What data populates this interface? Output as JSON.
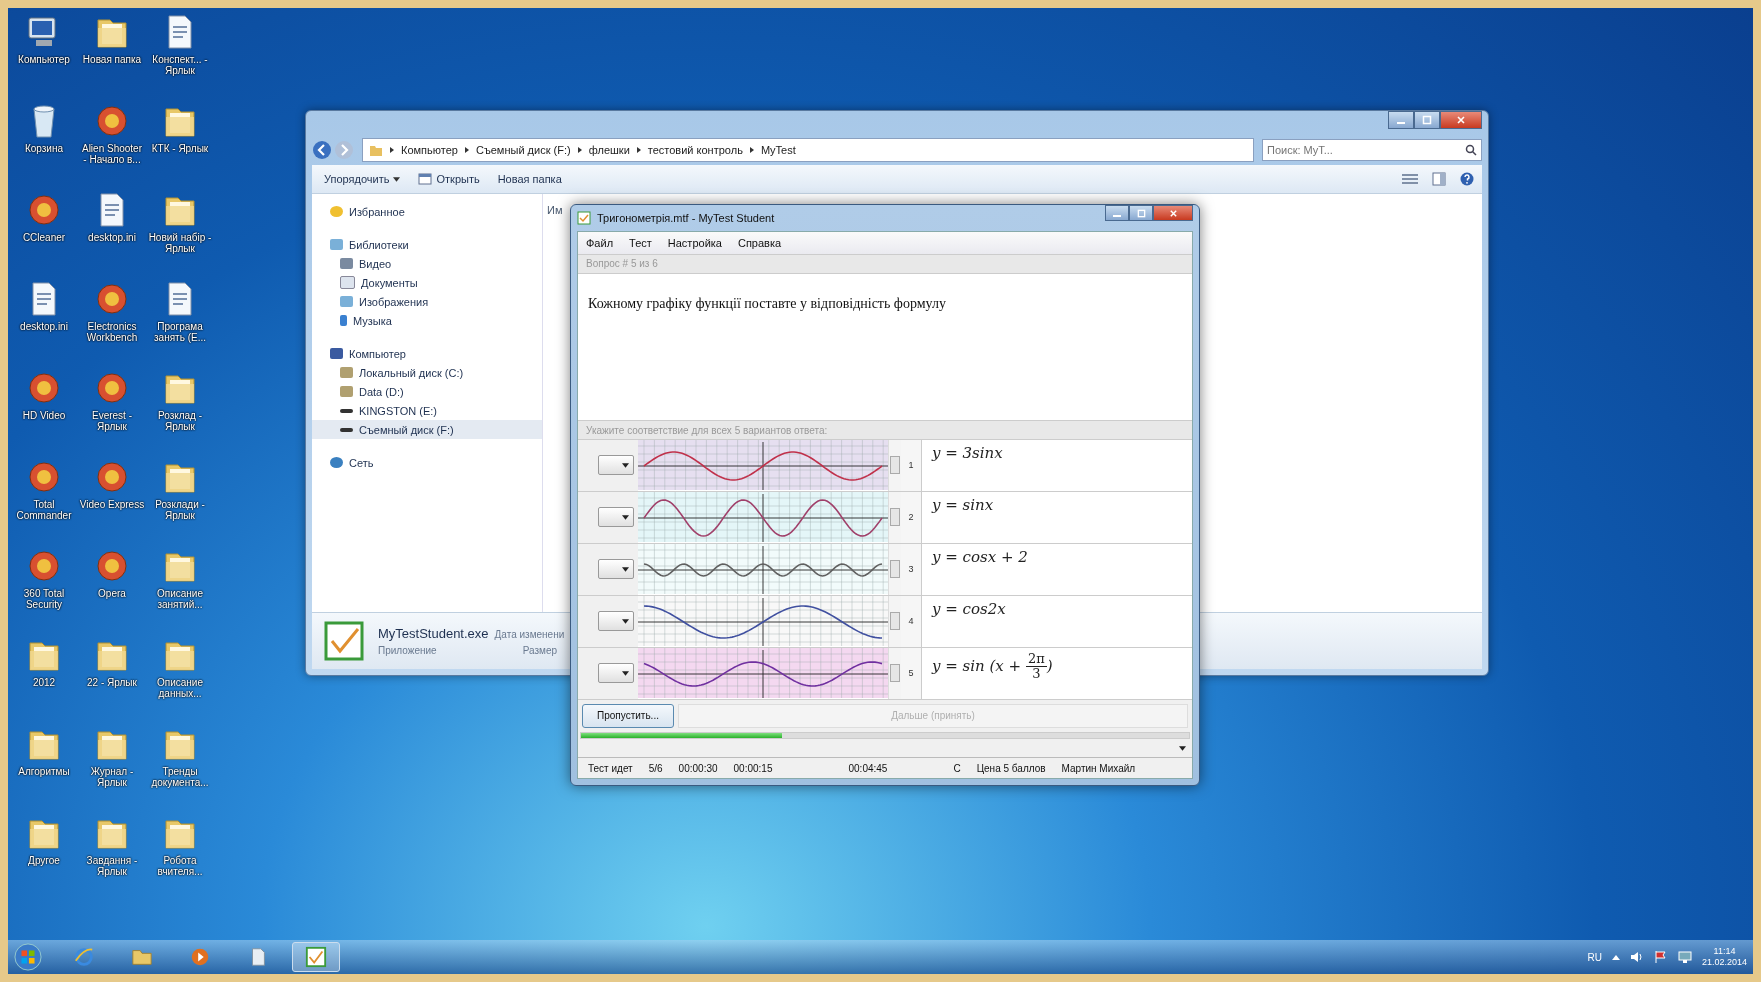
{
  "desktop_icons": [
    {
      "label": "Компьютер",
      "kind": "computer"
    },
    {
      "label": "Новая папка",
      "kind": "folder"
    },
    {
      "label": "Конспект... - Ярлык",
      "kind": "document"
    },
    {
      "label": "Корзина",
      "kind": "trash"
    },
    {
      "label": "Alien Shooter - Начало в...",
      "kind": "app"
    },
    {
      "label": "КТК - Ярлык",
      "kind": "folder"
    },
    {
      "label": "CCleaner",
      "kind": "app"
    },
    {
      "label": "desktop.ini",
      "kind": "document"
    },
    {
      "label": "Новий набір - Ярлык",
      "kind": "folder"
    },
    {
      "label": "desktop.ini",
      "kind": "document"
    },
    {
      "label": "Electronics Workbench",
      "kind": "app"
    },
    {
      "label": "Програма занять (Е...",
      "kind": "document"
    },
    {
      "label": "HD Video",
      "kind": "app"
    },
    {
      "label": "Everest - Ярлык",
      "kind": "app"
    },
    {
      "label": "Розклад - Ярлык",
      "kind": "folder"
    },
    {
      "label": "Total Commander",
      "kind": "app"
    },
    {
      "label": "Video Express",
      "kind": "app"
    },
    {
      "label": "Розклади - Ярлык",
      "kind": "folder"
    },
    {
      "label": "360 Total Security",
      "kind": "app"
    },
    {
      "label": "Opera",
      "kind": "app"
    },
    {
      "label": "Описание занятий...",
      "kind": "folder"
    },
    {
      "label": "2012",
      "kind": "folder"
    },
    {
      "label": "22 - Ярлык",
      "kind": "folder"
    },
    {
      "label": "Описание данных...",
      "kind": "folder"
    },
    {
      "label": "Алгоритмы",
      "kind": "folder"
    },
    {
      "label": "Журнал - Ярлык",
      "kind": "folder"
    },
    {
      "label": "Тренды документа...",
      "kind": "folder"
    },
    {
      "label": "Другое",
      "kind": "folder"
    },
    {
      "label": "Завдання - Ярлык",
      "kind": "folder"
    },
    {
      "label": "Робота вчителя...",
      "kind": "folder"
    }
  ],
  "explorer": {
    "breadcrumb": [
      "Компьютер",
      "Съемный диск (F:)",
      "флешки",
      "тестовий контроль",
      "MyTest"
    ],
    "search": {
      "placeholder": "Поиск: MyT..."
    },
    "toolbar": [
      {
        "label": "Упорядочить",
        "kind": "menu"
      },
      {
        "label": "Открыть",
        "kind": "open"
      },
      {
        "label": "Новая папка",
        "kind": "plain"
      }
    ],
    "sidebar": [
      {
        "label": "Избранное",
        "kind": "star",
        "selected": false
      },
      {
        "label": "Библиотеки",
        "kind": "library",
        "selected": false,
        "children": [
          {
            "label": "Видео",
            "kind": "video",
            "selected": false
          },
          {
            "label": "Документы",
            "kind": "document",
            "selected": false
          },
          {
            "label": "Изображения",
            "kind": "picture",
            "selected": false
          },
          {
            "label": "Музыка",
            "kind": "music",
            "selected": false
          }
        ]
      },
      {
        "label": "Компьютер",
        "kind": "computer",
        "selected": false,
        "children": [
          {
            "label": "Локальный диск (C:)",
            "kind": "disk",
            "selected": false
          },
          {
            "label": "Data (D:)",
            "kind": "disk",
            "selected": false
          },
          {
            "label": "KINGSTON (E:)",
            "kind": "usb",
            "selected": false
          },
          {
            "label": "Съемный диск (F:)",
            "kind": "usb",
            "selected": true
          }
        ]
      },
      {
        "label": "Сеть",
        "kind": "network",
        "selected": false
      }
    ],
    "list_header": "Им",
    "details": {
      "name": "MyTestStudent.exe",
      "modified_label": "Дата изменени",
      "type": "Приложение",
      "size_label": "Размер"
    }
  },
  "mytest": {
    "title": "Тригонометрія.mtf - MyTest Student",
    "menu": [
      "Файл",
      "Тест",
      "Настройка",
      "Справка"
    ],
    "question_number": "Вопрос # 5 из 6",
    "question": "Кожному графіку функції поставте у відповідність формулу",
    "instruction": "Укажите соответствие для всех 5 вариантов ответа:",
    "rows": [
      {
        "number": "1",
        "formula": {
          "kind": "plain",
          "text": "y = 3sinx"
        }
      },
      {
        "number": "2",
        "formula": {
          "kind": "plain",
          "text": "y = sinx"
        }
      },
      {
        "number": "3",
        "formula": {
          "kind": "plain",
          "text": "y = cosx + 2"
        }
      },
      {
        "number": "4",
        "formula": {
          "kind": "plain",
          "text": "y = cos2x"
        }
      },
      {
        "number": "5",
        "formula": {
          "kind": "fraction",
          "prefix": "y = sin (x + ",
          "numerator": "2π",
          "denominator": "3",
          "suffix": ")"
        }
      }
    ],
    "skip_button": "Пропустить...",
    "next_button": {
      "label": "Дальше (принять)",
      "disabled": true
    },
    "progress": {
      "level": 0.33
    },
    "status": [
      "Тест идет",
      "5/6",
      "00:00:30",
      "00:00:15",
      "00:04:45",
      "С",
      "Цена 5 баллов",
      "Мартин Михайл"
    ]
  },
  "taskbar": {
    "apps": [
      {
        "kind": "browser",
        "active": false
      },
      {
        "kind": "folder",
        "active": false
      },
      {
        "kind": "media",
        "active": false
      },
      {
        "kind": "document",
        "active": false
      },
      {
        "kind": "mytest",
        "active": true
      }
    ],
    "tray": {
      "language": "RU",
      "time": "11:14",
      "date": "21.02.2014"
    }
  }
}
